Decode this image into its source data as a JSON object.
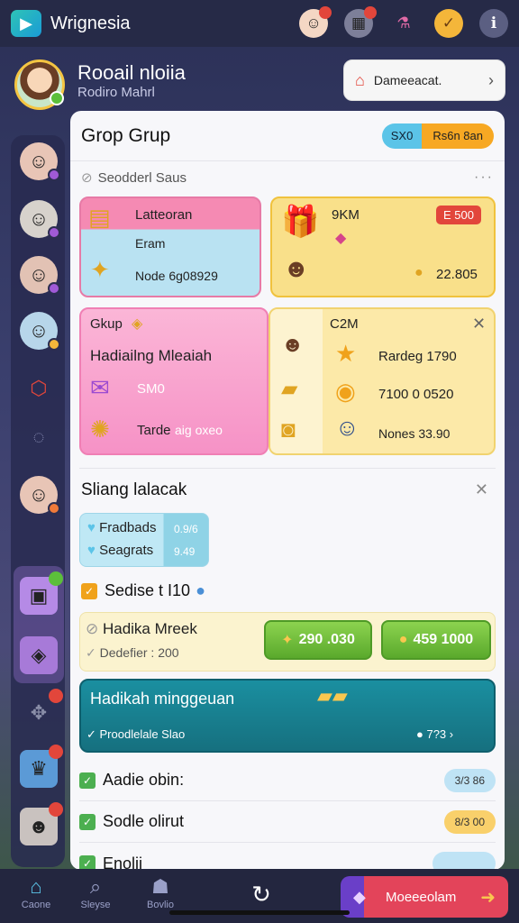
{
  "header": {
    "app_title": "Wrignesia",
    "icons": [
      "smiley-icon",
      "store-icon",
      "potion-icon",
      "coin-icon",
      "info-icon"
    ]
  },
  "profile": {
    "name": "Rooail nloiia",
    "subtitle": "Rodiro Mahrl",
    "cta_label": "Dameeacat."
  },
  "panel": {
    "title": "Grop Grup",
    "pill_left": "SX0",
    "pill_right": "Rs6n 8an",
    "section_label": "Seodderl Saus",
    "card_a": {
      "title": "Latteoran",
      "line2": "Eram",
      "line3": "Node 6g08929"
    },
    "card_b": {
      "title": "9KM",
      "tag": "E 500",
      "value": "22.805"
    },
    "card_c": {
      "title": "Gkup",
      "line2": "Hadiailng Mleaiah",
      "line3": "SM0",
      "line4": "Tarde",
      "line4b": "aig oxeo"
    },
    "card_d": {
      "title": "C2M",
      "row1": "Rardeg 1790",
      "row2": "7100 0 0520",
      "row3": "Nones 33.90"
    },
    "list_title": "Sliang lalacak",
    "mini_rows": [
      {
        "label": "Fradbads",
        "value": "0.9/6"
      },
      {
        "label": "Seagrats",
        "value": "9.49"
      }
    ],
    "check_line": "Sedise t I10",
    "offer": {
      "title": "Hadika Mreek",
      "sub": "Dedefier : 200",
      "btn1": "290 .030",
      "btn2": "459 1000"
    },
    "banner": {
      "title": "Hadikah minggeuan",
      "sub": "Proodlelale Slao",
      "value": "7?3"
    },
    "tasks": [
      {
        "label": "Aadie obin:",
        "pill": "3/3 86",
        "pill_color": "#bfe3f5"
      },
      {
        "label": "Sodle olirut",
        "pill": "8/3 00",
        "pill_color": "#f9d06b"
      },
      {
        "label": "Enolii",
        "pill": "",
        "pill_color": "#bfe3f5"
      }
    ]
  },
  "bottom_nav": {
    "items": [
      {
        "label": "Caone",
        "icon": "home-icon"
      },
      {
        "label": "Sleyse",
        "icon": "search-icon"
      },
      {
        "label": "Bovlio",
        "icon": "profile-icon"
      }
    ],
    "cta_label": "Moeeeolam"
  },
  "colors": {
    "accent_pink": "#f58ab3",
    "accent_yellow": "#f9e08a",
    "accent_teal": "#16707f",
    "accent_green": "#5aa92c"
  }
}
